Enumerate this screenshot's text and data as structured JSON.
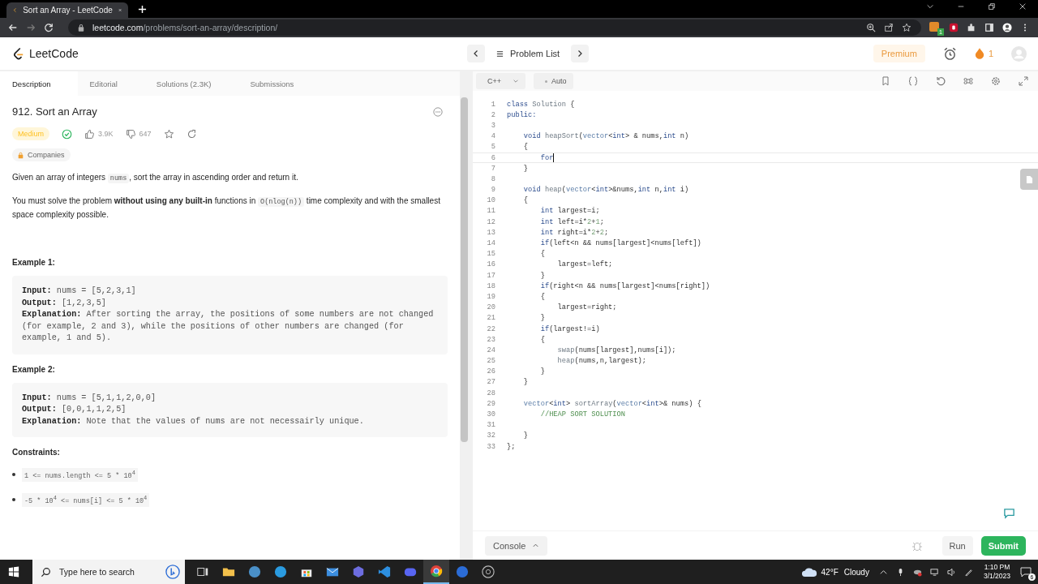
{
  "browser": {
    "tab_title": "Sort an Array - LeetCode",
    "url": {
      "host": "leetcode.com",
      "path": "/problems/sort-an-array/description/"
    },
    "extension_badge": "1"
  },
  "header": {
    "logo": "LeetCode",
    "problem_list": "Problem List",
    "premium": "Premium",
    "streak": "1"
  },
  "tabs": [
    {
      "label": "Description",
      "selected": true
    },
    {
      "label": "Editorial",
      "selected": false
    },
    {
      "label": "Solutions (2.3K)",
      "selected": false
    },
    {
      "label": "Submissions",
      "selected": false
    }
  ],
  "problem": {
    "title": "912. Sort an Array",
    "difficulty": "Medium",
    "solved": true,
    "likes": "3.9K",
    "dislikes": "647",
    "companies": "Companies",
    "paragraphs": [
      [
        {
          "kind": "text",
          "text": "Given an array of integers "
        },
        {
          "kind": "code",
          "text": "nums"
        },
        {
          "kind": "text",
          "text": ", sort the array in ascending order and return it."
        }
      ],
      [
        {
          "kind": "text",
          "text": "You must solve the problem "
        },
        {
          "kind": "bold",
          "text": "without using any built-in"
        },
        {
          "kind": "text",
          "text": " functions in "
        },
        {
          "kind": "code",
          "text": "O(nlog(n))"
        },
        {
          "kind": "text",
          "text": " time complexity and with the smallest space complexity possible."
        }
      ]
    ],
    "examples": [
      {
        "heading": "Example 1:",
        "lines": [
          {
            "label": "Input:",
            "text": "nums = [5,2,3,1]"
          },
          {
            "label": "Output:",
            "text": "[1,2,3,5]"
          },
          {
            "label": "Explanation:",
            "text": "After sorting the array, the positions of some numbers are not changed (for example, 2 and 3), while the positions of other numbers are changed (for example, 1 and 5)."
          }
        ]
      },
      {
        "heading": "Example 2:",
        "lines": [
          {
            "label": "Input:",
            "text": "nums = [5,1,1,2,0,0]"
          },
          {
            "label": "Output:",
            "text": "[0,0,1,1,2,5]"
          },
          {
            "label": "Explanation:",
            "text": "Note that the values of nums are not necessairly unique."
          }
        ]
      }
    ],
    "constraints_heading": "Constraints:",
    "constraints": [
      "1 <= nums.length <= 5 * 10$^{4}$",
      "-5 * 10$^{4}$ <= nums[i] <= 5 * 10$^{4}$"
    ]
  },
  "editor": {
    "language": "C++",
    "mode": "Auto",
    "lines": [
      {
        "number": "1",
        "active": false,
        "segments": [
          {
            "kind": "kw",
            "text": "class"
          },
          {
            "kind": "fn",
            "text": " Solution"
          },
          {
            "kind": "p",
            "text": " {"
          }
        ]
      },
      {
        "number": "2",
        "active": false,
        "segments": [
          {
            "kind": "kw",
            "text": "public:"
          }
        ]
      },
      {
        "number": "3",
        "active": false
      },
      {
        "number": "4",
        "active": false,
        "segments": [
          {
            "kind": "kw",
            "text": "    void"
          },
          {
            "kind": "fn",
            "text": " heapSort"
          },
          {
            "kind": "p",
            "text": "("
          },
          {
            "kind": "ty",
            "text": "vector"
          },
          {
            "kind": "p",
            "text": "<"
          },
          {
            "kind": "kw",
            "text": "int"
          },
          {
            "kind": "p",
            "text": "> & nums,"
          },
          {
            "kind": "kw",
            "text": "int"
          },
          {
            "kind": "p",
            "text": " n)"
          }
        ]
      },
      {
        "number": "5",
        "active": false,
        "segments": [
          {
            "kind": "p",
            "text": "    {"
          }
        ]
      },
      {
        "number": "6",
        "active": true,
        "segments": [
          {
            "kind": "kw",
            "text": "        for"
          }
        ]
      },
      {
        "number": "7",
        "active": false,
        "segments": [
          {
            "kind": "p",
            "text": "    }"
          }
        ]
      },
      {
        "number": "8",
        "active": false
      },
      {
        "number": "9",
        "active": false,
        "segments": [
          {
            "kind": "kw",
            "text": "    void"
          },
          {
            "kind": "fn",
            "text": " heap"
          },
          {
            "kind": "p",
            "text": "("
          },
          {
            "kind": "ty",
            "text": "vector"
          },
          {
            "kind": "p",
            "text": "<"
          },
          {
            "kind": "kw",
            "text": "int"
          },
          {
            "kind": "p",
            "text": ">&nums,"
          },
          {
            "kind": "kw",
            "text": "int"
          },
          {
            "kind": "p",
            "text": " n,"
          },
          {
            "kind": "kw",
            "text": "int"
          },
          {
            "kind": "p",
            "text": " i)"
          }
        ]
      },
      {
        "number": "10",
        "active": false,
        "segments": [
          {
            "kind": "p",
            "text": "    {"
          }
        ]
      },
      {
        "number": "11",
        "active": false,
        "segments": [
          {
            "kind": "kw",
            "text": "        int"
          },
          {
            "kind": "p",
            "text": " largest=i;"
          }
        ]
      },
      {
        "number": "12",
        "active": false,
        "segments": [
          {
            "kind": "kw",
            "text": "        int"
          },
          {
            "kind": "p",
            "text": " left=i*"
          },
          {
            "kind": "n",
            "text": "2"
          },
          {
            "kind": "p",
            "text": "+"
          },
          {
            "kind": "n",
            "text": "1"
          },
          {
            "kind": "p",
            "text": ";"
          }
        ]
      },
      {
        "number": "13",
        "active": false,
        "segments": [
          {
            "kind": "kw",
            "text": "        int"
          },
          {
            "kind": "p",
            "text": " right=i*"
          },
          {
            "kind": "n",
            "text": "2"
          },
          {
            "kind": "p",
            "text": "+"
          },
          {
            "kind": "n",
            "text": "2"
          },
          {
            "kind": "p",
            "text": ";"
          }
        ]
      },
      {
        "number": "14",
        "active": false,
        "segments": [
          {
            "kind": "kw",
            "text": "        if"
          },
          {
            "kind": "p",
            "text": "(left<n && nums[largest]<nums[left])"
          }
        ]
      },
      {
        "number": "15",
        "active": false,
        "segments": [
          {
            "kind": "p",
            "text": "        {"
          }
        ]
      },
      {
        "number": "16",
        "active": false,
        "segments": [
          {
            "kind": "p",
            "text": "            largest=left;"
          }
        ]
      },
      {
        "number": "17",
        "active": false,
        "segments": [
          {
            "kind": "p",
            "text": "        }"
          }
        ]
      },
      {
        "number": "18",
        "active": false,
        "segments": [
          {
            "kind": "kw",
            "text": "        if"
          },
          {
            "kind": "p",
            "text": "(right<n && nums[largest]<nums[right])"
          }
        ]
      },
      {
        "number": "19",
        "active": false,
        "segments": [
          {
            "kind": "p",
            "text": "        {"
          }
        ]
      },
      {
        "number": "20",
        "active": false,
        "segments": [
          {
            "kind": "p",
            "text": "            largest=right;"
          }
        ]
      },
      {
        "number": "21",
        "active": false,
        "segments": [
          {
            "kind": "p",
            "text": "        }"
          }
        ]
      },
      {
        "number": "22",
        "active": false,
        "segments": [
          {
            "kind": "kw",
            "text": "        if"
          },
          {
            "kind": "p",
            "text": "(largest!=i)"
          }
        ]
      },
      {
        "number": "23",
        "active": false,
        "segments": [
          {
            "kind": "p",
            "text": "        {"
          }
        ]
      },
      {
        "number": "24",
        "active": false,
        "segments": [
          {
            "kind": "fn",
            "text": "            swap"
          },
          {
            "kind": "p",
            "text": "(nums[largest],nums[i]);"
          }
        ]
      },
      {
        "number": "25",
        "active": false,
        "segments": [
          {
            "kind": "fn",
            "text": "            heap"
          },
          {
            "kind": "p",
            "text": "(nums,n,largest);"
          }
        ]
      },
      {
        "number": "26",
        "active": false,
        "segments": [
          {
            "kind": "p",
            "text": "        }"
          }
        ]
      },
      {
        "number": "27",
        "active": false,
        "segments": [
          {
            "kind": "p",
            "text": "    }"
          }
        ]
      },
      {
        "number": "28",
        "active": false
      },
      {
        "number": "29",
        "active": false,
        "segments": [
          {
            "kind": "ty",
            "text": "    vector"
          },
          {
            "kind": "p",
            "text": "<"
          },
          {
            "kind": "kw",
            "text": "int"
          },
          {
            "kind": "p",
            "text": ">"
          },
          {
            "kind": "fn",
            "text": " sortArray"
          },
          {
            "kind": "p",
            "text": "("
          },
          {
            "kind": "ty",
            "text": "vector"
          },
          {
            "kind": "p",
            "text": "<"
          },
          {
            "kind": "kw",
            "text": "int"
          },
          {
            "kind": "p",
            "text": ">& nums) {"
          }
        ]
      },
      {
        "number": "30",
        "active": false,
        "segments": [
          {
            "kind": "cm",
            "text": "        //HEAP SORT SOLUTION"
          }
        ]
      },
      {
        "number": "31",
        "active": false
      },
      {
        "number": "32",
        "active": false,
        "segments": [
          {
            "kind": "p",
            "text": "    }"
          }
        ]
      },
      {
        "number": "33",
        "active": false,
        "segments": [
          {
            "kind": "p",
            "text": "};"
          }
        ]
      }
    ]
  },
  "console": {
    "console": "Console",
    "run": "Run",
    "submit": "Submit"
  },
  "taskbar": {
    "search_placeholder": "Type here to search",
    "apps": [
      {
        "kind": "taskview",
        "selected": false
      },
      {
        "kind": "folder",
        "selected": false
      },
      {
        "kind": "steam",
        "selected": false
      },
      {
        "kind": "edge",
        "selected": false
      },
      {
        "kind": "store",
        "selected": false
      },
      {
        "kind": "mail",
        "selected": false
      },
      {
        "kind": "hexagon",
        "selected": false
      },
      {
        "kind": "vscode",
        "selected": false
      },
      {
        "kind": "discord",
        "selected": false
      },
      {
        "kind": "chrome",
        "selected": true
      },
      {
        "kind": "circle",
        "selected": false
      },
      {
        "kind": "obs",
        "selected": false
      }
    ],
    "temperature": "42°F",
    "weather": "Cloudy",
    "time": "1:10 PM",
    "date": "3/1/2023",
    "notifications": "6"
  }
}
